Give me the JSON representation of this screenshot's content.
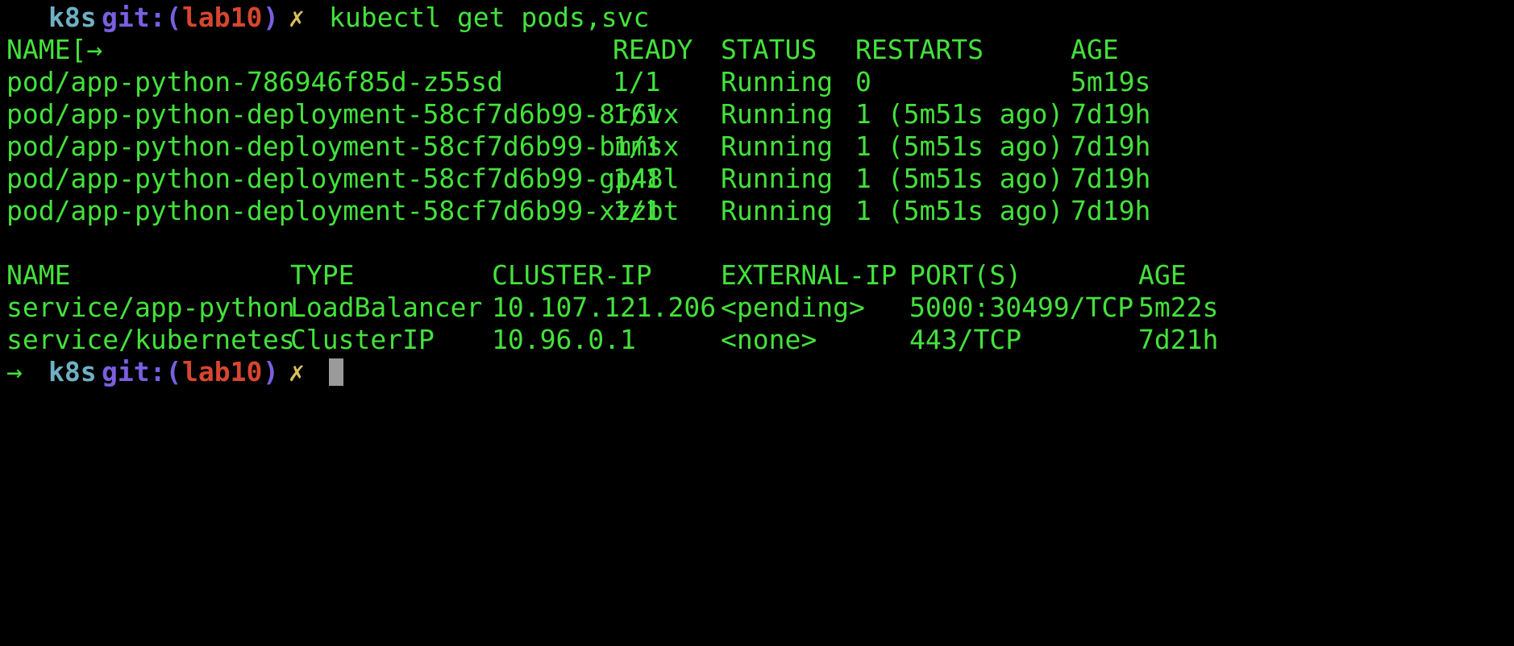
{
  "colors": {
    "background": "#000000",
    "output_text": "#44e13c",
    "prompt_dir": "#6fb0c4",
    "prompt_git": "#7a5fe0",
    "prompt_branch": "#d8462f",
    "prompt_dirty_marker": "#d8c05a",
    "cursor": "#9a9a9a"
  },
  "prompt": {
    "arrow_first": "[→",
    "arrow": "→",
    "dir": "k8s",
    "git_open": "git:(",
    "branch": "lab10",
    "git_close": ")",
    "dirty": "✗",
    "command": "kubectl get pods,svc"
  },
  "pods": {
    "headers": {
      "name": "NAME",
      "ready": "READY",
      "status": "STATUS",
      "restarts": "RESTARTS",
      "age": "AGE"
    },
    "rows": [
      {
        "name": "pod/app-python-786946f85d-z55sd",
        "ready": "1/1",
        "status": "Running",
        "restarts": "0",
        "age": "5m19s"
      },
      {
        "name": "pod/app-python-deployment-58cf7d6b99-8r6vx",
        "ready": "1/1",
        "status": "Running",
        "restarts": "1 (5m51s ago)",
        "age": "7d19h"
      },
      {
        "name": "pod/app-python-deployment-58cf7d6b99-bmmsx",
        "ready": "1/1",
        "status": "Running",
        "restarts": "1 (5m51s ago)",
        "age": "7d19h"
      },
      {
        "name": "pod/app-python-deployment-58cf7d6b99-gp48l",
        "ready": "1/1",
        "status": "Running",
        "restarts": "1 (5m51s ago)",
        "age": "7d19h"
      },
      {
        "name": "pod/app-python-deployment-58cf7d6b99-xzzbt",
        "ready": "1/1",
        "status": "Running",
        "restarts": "1 (5m51s ago)",
        "age": "7d19h"
      }
    ]
  },
  "services": {
    "headers": {
      "name": "NAME",
      "type": "TYPE",
      "cluster_ip": "CLUSTER-IP",
      "external_ip": "EXTERNAL-IP",
      "ports": "PORT(S)",
      "age": "AGE"
    },
    "rows": [
      {
        "name": "service/app-python",
        "type": "LoadBalancer",
        "cluster_ip": "10.107.121.206",
        "external_ip": "<pending>",
        "ports": "5000:30499/TCP",
        "age": "5m22s"
      },
      {
        "name": "service/kubernetes",
        "type": "ClusterIP",
        "cluster_ip": "10.96.0.1",
        "external_ip": "<none>",
        "ports": "443/TCP",
        "age": "7d21h"
      }
    ]
  }
}
